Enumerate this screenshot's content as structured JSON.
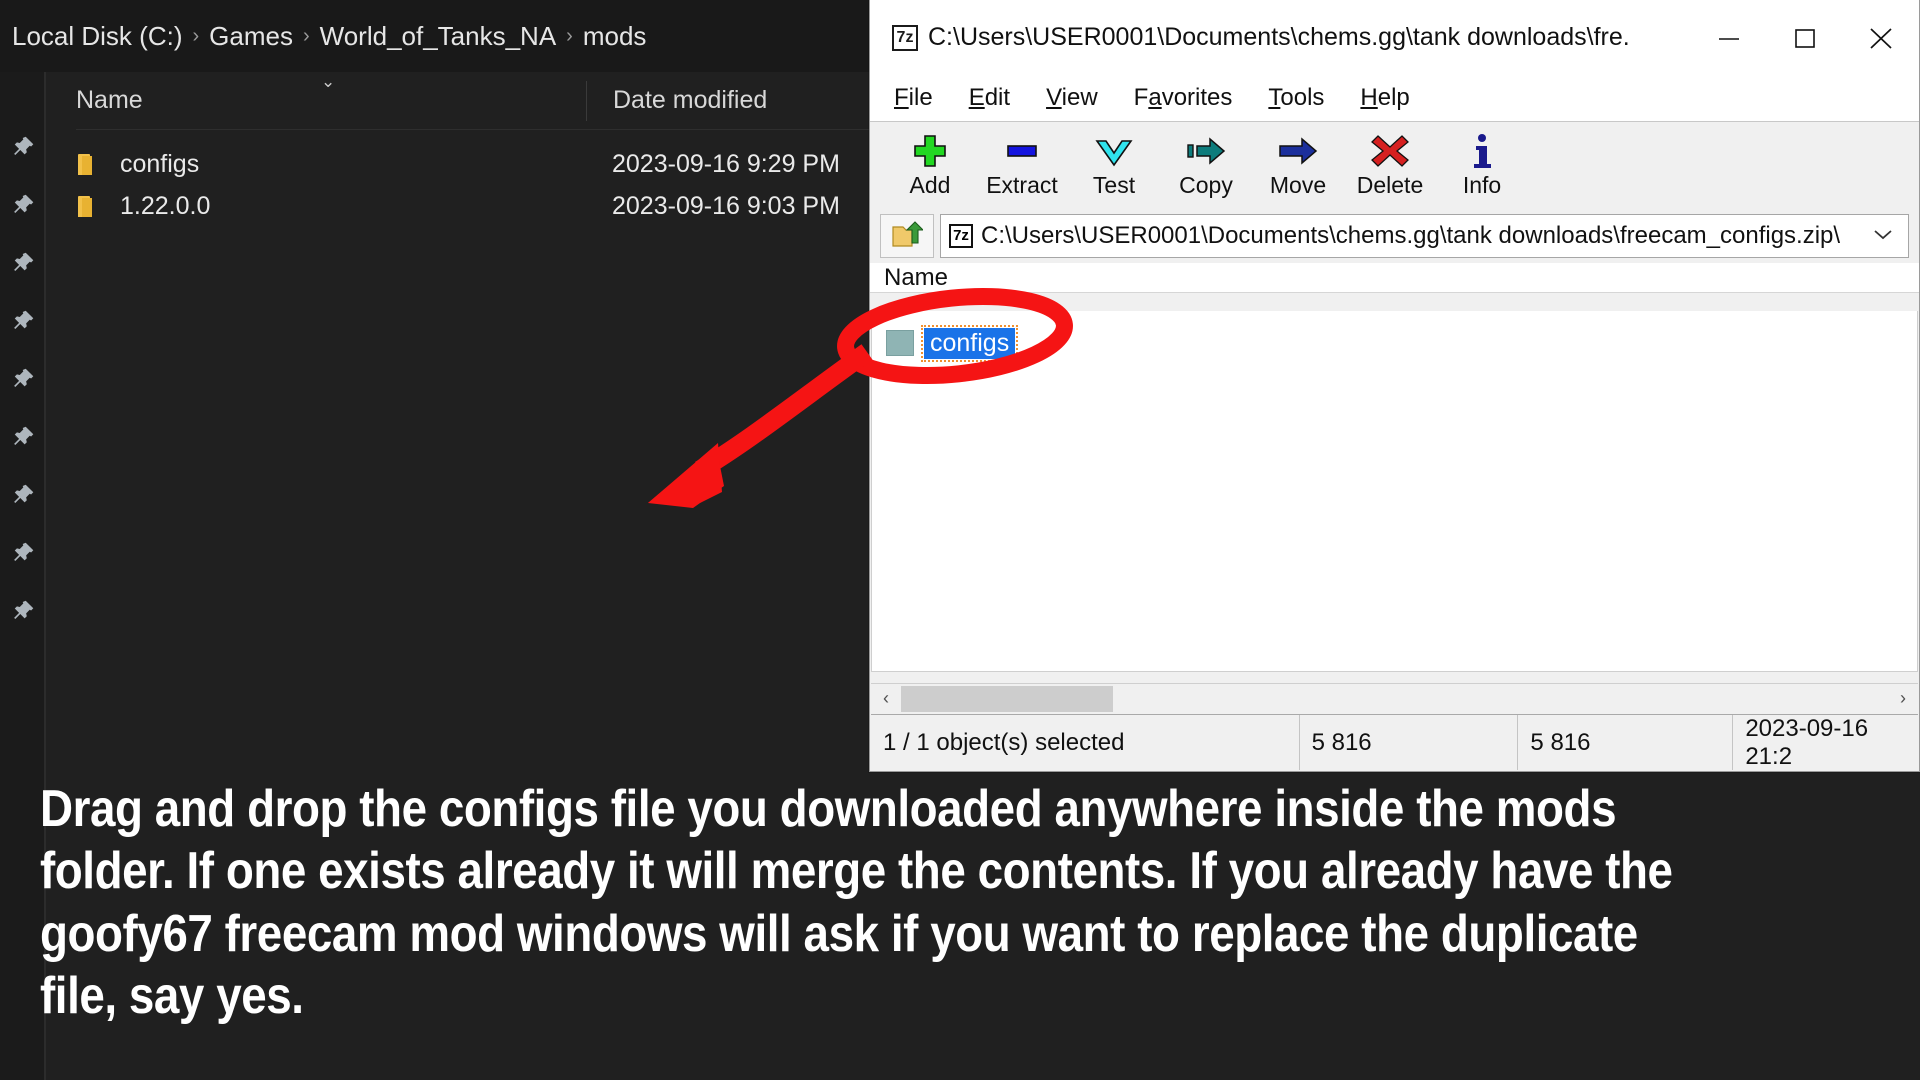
{
  "explorer": {
    "breadcrumb": [
      "Local Disk (C:)",
      "Games",
      "World_of_Tanks_NA",
      "mods"
    ],
    "separator": "›",
    "columns": {
      "name": "Name",
      "date": "Date modified"
    },
    "sort_caret": "⌄",
    "rows": [
      {
        "name": "configs",
        "date": "2023-09-16 9:29 PM"
      },
      {
        "name": "1.22.0.0",
        "date": "2023-09-16 9:03 PM"
      }
    ],
    "sidebar": {
      "pin_count": 9,
      "icon": "pin-icon"
    }
  },
  "sevenzip": {
    "title": "C:\\Users\\USER0001\\Documents\\chems.gg\\tank downloads\\fre...",
    "app_icon_text": "7z",
    "window_controls": {
      "minimize": "minimize-icon",
      "maximize": "maximize-icon",
      "close": "close-icon"
    },
    "menu": [
      {
        "label": "File",
        "accel": "F"
      },
      {
        "label": "Edit",
        "accel": "E"
      },
      {
        "label": "View",
        "accel": "V"
      },
      {
        "label": "Favorites",
        "accel": "a"
      },
      {
        "label": "Tools",
        "accel": "T"
      },
      {
        "label": "Help",
        "accel": "H"
      }
    ],
    "toolbar": [
      {
        "label": "Add",
        "icon": "plus-icon",
        "color": "#22d822"
      },
      {
        "label": "Extract",
        "icon": "minus-icon",
        "color": "#1414e0"
      },
      {
        "label": "Test",
        "icon": "check-down-icon",
        "color": "#30e4ee"
      },
      {
        "label": "Copy",
        "icon": "copy-arrow-icon",
        "color": "#0d7c7c"
      },
      {
        "label": "Move",
        "icon": "move-arrow-icon",
        "color": "#1b2f9c"
      },
      {
        "label": "Delete",
        "icon": "delete-x-icon",
        "color": "#d62020"
      },
      {
        "label": "Info",
        "icon": "info-icon",
        "color": "#1a1a8c"
      }
    ],
    "address": {
      "up_button": "folder-up-icon",
      "icon_text": "7z",
      "path": "C:\\Users\\USER0001\\Documents\\chems.gg\\tank downloads\\freecam_configs.zip\\",
      "dropdown": "chevron-down-icon"
    },
    "list_header": {
      "name": "Name"
    },
    "items": [
      {
        "name": "configs",
        "selected": true,
        "icon": "folder-archive-icon"
      }
    ],
    "scrollbar": {
      "left_arrow": "‹",
      "right_arrow": "›"
    },
    "status": {
      "selection": "1 / 1 object(s) selected",
      "size": "5 816",
      "packed_size": "5 816",
      "modified": "2023-09-16 21:2"
    }
  },
  "annotation": {
    "color": "#f51414",
    "shape": "ellipse-with-arrow",
    "target": "configs"
  },
  "caption": {
    "text": "Drag and drop the configs file you downloaded anywhere inside the mods folder. If one exists already it will merge the contents. If you already have the goofy67 freecam mod windows will ask if you want to replace the duplicate file, say yes."
  }
}
